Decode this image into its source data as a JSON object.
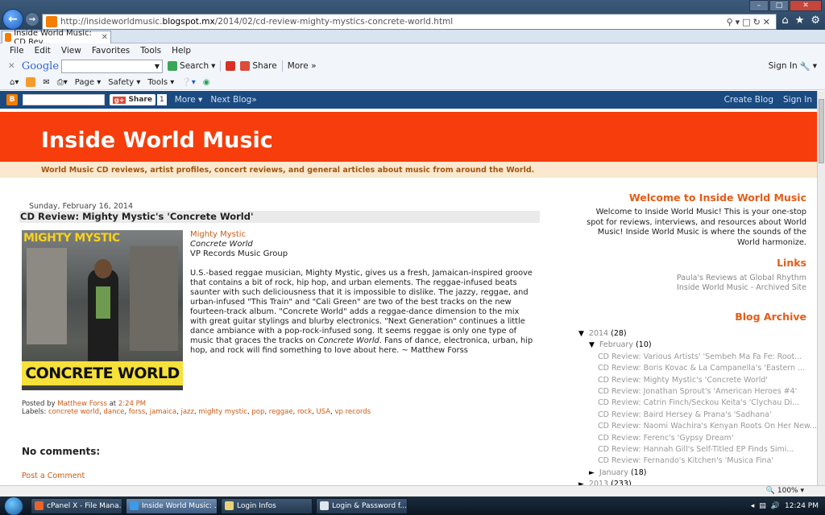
{
  "browser": {
    "url_prefix": "http://insideworldmusic.",
    "url_domain": "blogspot.mx",
    "url_path": "/2014/02/cd-review-mighty-mystics-concrete-world.html",
    "tab_title": "Inside World Music: CD Rev...",
    "menu": [
      "File",
      "Edit",
      "View",
      "Favorites",
      "Tools",
      "Help"
    ],
    "google": {
      "logo": "Google",
      "search": "Search",
      "share": "Share",
      "more": "More »",
      "signin": "Sign In"
    },
    "cmd": {
      "page": "Page",
      "safety": "Safety",
      "tools": "Tools"
    },
    "zoom": "100%"
  },
  "blogger_nav": {
    "share": "Share",
    "share_count": "1",
    "more": "More",
    "next": "Next Blog»",
    "create": "Create Blog",
    "signin": "Sign In"
  },
  "blog": {
    "title": "Inside World Music",
    "tagline": "World Music CD reviews, artist profiles, concert reviews, and general articles about music from around the World."
  },
  "post": {
    "date": "Sunday, February 16, 2014",
    "title": "CD Review: Mighty Mystic's 'Concrete World'",
    "cover_top": "MIGHTY MYSTIC",
    "cover_bottom": "CONCRETE WORLD",
    "artist": "Mighty Mystic",
    "album": "Concrete World",
    "label": "VP Records Music Group",
    "review_1": "U.S.-based reggae musician, Mighty Mystic, gives us a fresh, Jamaican-inspired groove that contains a bit of rock, hip hop, and urban elements. The reggae-infused beats saunter with such deliciousness that it is impossible to dislike. The jazzy, reggae, and urban-infused \"This Train\" and \"Cali Green\" are two of the best tracks on the new fourteen-track album. \"Concrete World\" adds a reggae-dance dimension to the mix with great guitar stylings and blurby electronics. \"Next Generation\" continues a little dance ambiance with a pop-rock-infused song. It seems reggae is only one type of music that graces the tracks on ",
    "review_em": "Concrete World",
    "review_2": ". Fans of dance, electronica, urban, hip hop, and rock will find something to love about here. ~ Matthew Forss",
    "posted_by_prefix": "Posted by ",
    "author": "Matthew Forss",
    "at": " at ",
    "time": "2:24 PM",
    "labels_prefix": "Labels: ",
    "labels": [
      "concrete world",
      "dance",
      "forss",
      "jamaica",
      "jazz",
      "mighty mystic",
      "pop",
      "reggae",
      "rock",
      "USA",
      "vp records"
    ],
    "no_comments": "No comments:",
    "post_comment": "Post a Comment"
  },
  "sidebar": {
    "welcome_title": "Welcome to Inside World Music",
    "welcome_text": "Welcome to Inside World Music! This is your one-stop spot for reviews, interviews, and resources about World Music! Inside World Music is where the sounds of the World harmonize.",
    "links_title": "Links",
    "links": [
      "Paula's Reviews at Global Rhythm",
      "Inside World Music - Archived Site"
    ],
    "archive_title": "Blog Archive",
    "year": "2014",
    "year_count": "(28)",
    "month": "February",
    "month_count": "(10)",
    "posts": [
      "CD Review: Various Artists' 'Sembeh Ma Fa Fe: Root...",
      "CD Review: Boris Kovac & La Campanella's 'Eastern ...",
      "CD Review: Mighty Mystic's 'Concrete World'",
      "CD Review: Jonathan Sprout's 'American Heroes #4'",
      "CD Review: Catrin Finch/Seckou Keita's 'Clychau Di...",
      "CD Review: Baird Hersey & Prana's 'Sadhana'",
      "CD Review: Naomi Wachira's Kenyan Roots On Her New...",
      "CD Review: Ferenc's 'Gypsy Dream'",
      "CD Review: Hannah Gill's Self-Titled EP Finds Simi...",
      "CD Review: Fernando's Kitchen's 'Musica Fina'"
    ],
    "month2": "January",
    "month2_count": "(18)",
    "year2": "2013",
    "year2_count": "(233)"
  },
  "taskbar": {
    "tasks": [
      "cPanel X - File Mana...",
      "Inside World Music: ...",
      "Login Infos",
      "Login & Password f..."
    ],
    "time": "12:24 PM"
  },
  "colors": {
    "header": "#f63d0b",
    "accent": "#e65c15",
    "tagline_bg": "#fbe9cf",
    "nav": "#1a4a80"
  }
}
